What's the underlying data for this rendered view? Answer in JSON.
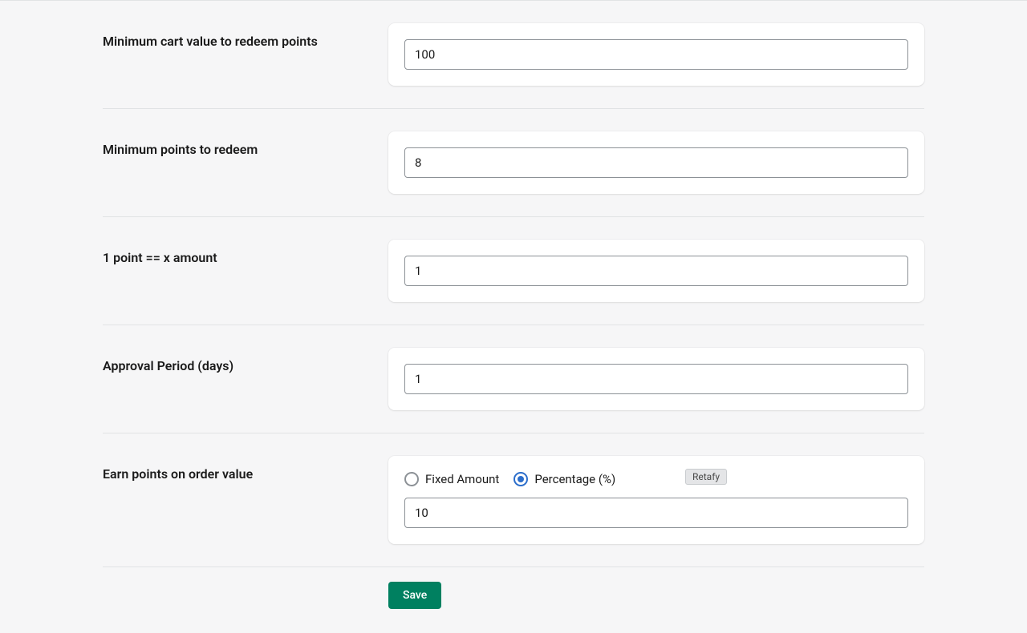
{
  "rows": {
    "min_cart": {
      "label": "Minimum cart value to redeem points",
      "value": "100"
    },
    "min_points": {
      "label": "Minimum points to redeem",
      "value": "8"
    },
    "point_amount": {
      "label": "1 point == x amount",
      "value": "1"
    },
    "approval": {
      "label": "Approval Period (days)",
      "value": "1"
    },
    "earn": {
      "label": "Earn points on order value",
      "option_fixed": "Fixed Amount",
      "option_percentage": "Percentage (%)",
      "selected": "percentage",
      "value": "10",
      "badge": "Retafy"
    }
  },
  "actions": {
    "save": "Save"
  }
}
